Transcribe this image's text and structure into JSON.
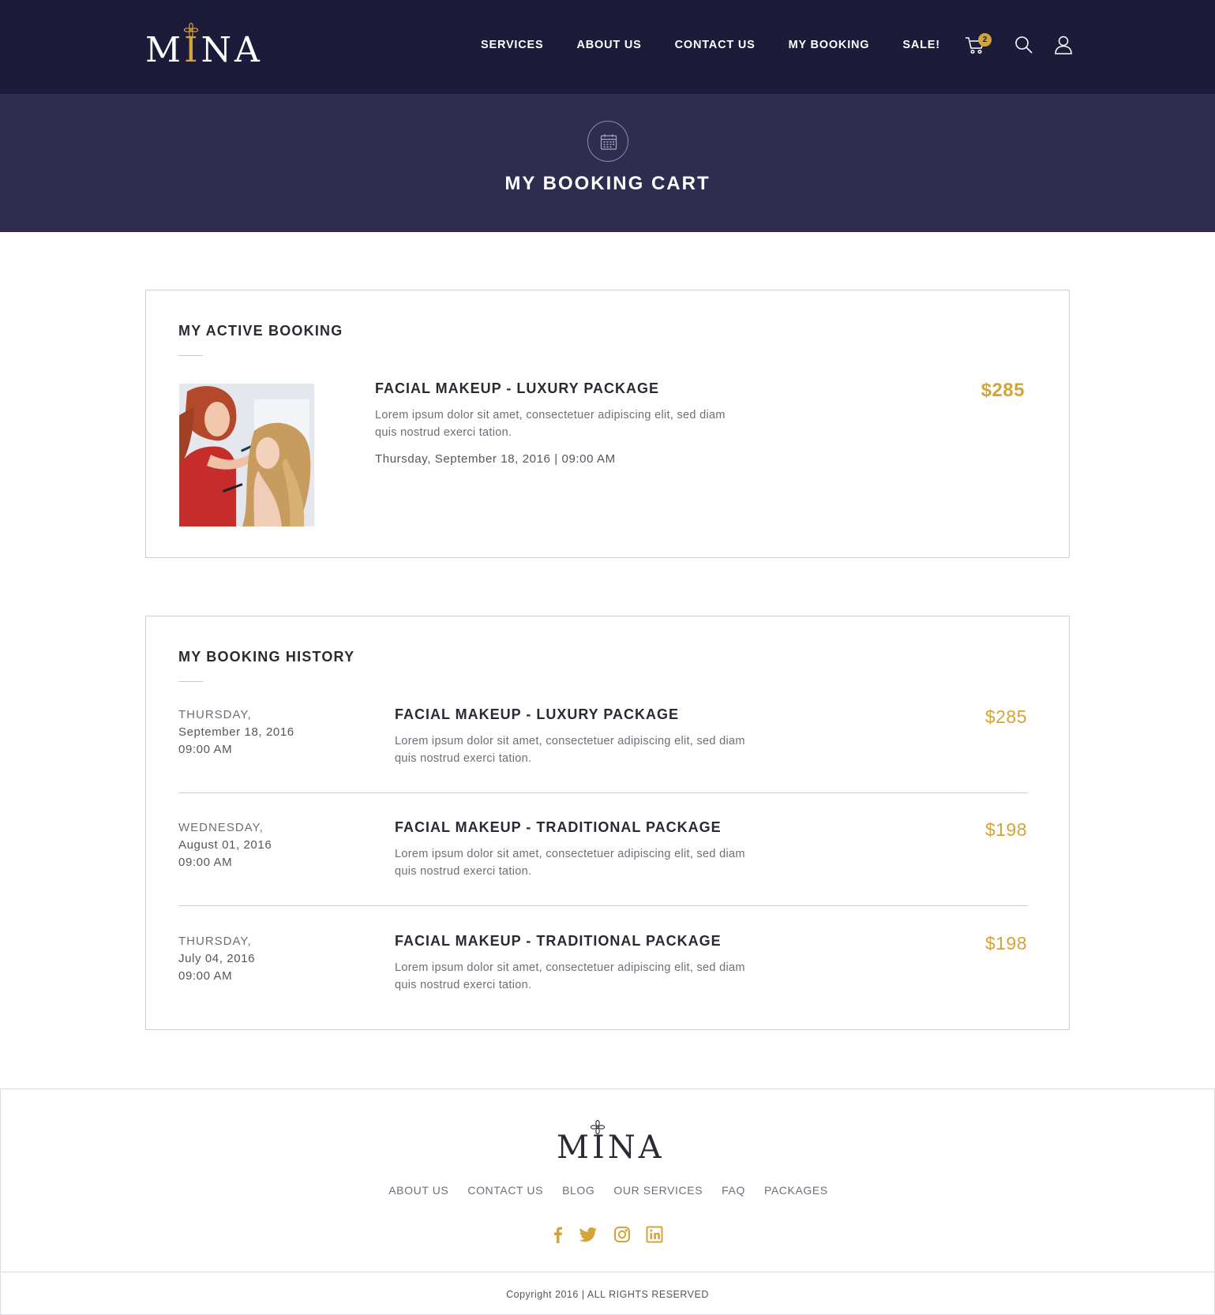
{
  "brand": {
    "name_prefix": "M",
    "name_accent": "I",
    "name_suffix": "NA",
    "accent_color": "#d4a437",
    "header_bg": "#1c1c3a",
    "hero_bg": "#2e2d4f"
  },
  "nav": {
    "items": [
      {
        "label": "SERVICES"
      },
      {
        "label": "ABOUT US"
      },
      {
        "label": "CONTACT US"
      },
      {
        "label": "MY BOOKING"
      },
      {
        "label": "SALE!"
      }
    ],
    "cart_count": "2",
    "icons": [
      "cart-icon",
      "search-icon",
      "user-icon"
    ]
  },
  "hero": {
    "icon": "calendar-icon",
    "title": "MY BOOKING CART"
  },
  "active_booking": {
    "heading": "MY ACTIVE BOOKING",
    "title": "FACIAL MAKEUP - LUXURY PACKAGE",
    "description": "Lorem ipsum dolor sit amet, consectetuer adipiscing elit, sed diam quis nostrud exerci tation.",
    "datetime": "Thursday, September 18, 2016 | 09:00 AM",
    "price": "$285"
  },
  "history": {
    "heading": "MY BOOKING HISTORY",
    "rows": [
      {
        "day": "THURSDAY,",
        "date": "September 18, 2016",
        "time": "09:00 AM",
        "title": "FACIAL MAKEUP - LUXURY PACKAGE",
        "description": "Lorem ipsum dolor sit amet, consectetuer adipiscing elit, sed diam quis nostrud exerci tation.",
        "price": "$285"
      },
      {
        "day": "WEDNESDAY,",
        "date": "August 01, 2016",
        "time": "09:00 AM",
        "title": "FACIAL MAKEUP - TRADITIONAL PACKAGE",
        "description": "Lorem ipsum dolor sit amet, consectetuer adipiscing elit, sed diam quis nostrud exerci tation.",
        "price": "$198"
      },
      {
        "day": "THURSDAY,",
        "date": "July 04, 2016",
        "time": "09:00 AM",
        "title": "FACIAL MAKEUP - TRADITIONAL PACKAGE",
        "description": "Lorem ipsum dolor sit amet, consectetuer adipiscing elit, sed diam quis nostrud exerci tation.",
        "price": "$198"
      }
    ]
  },
  "footer": {
    "links": [
      {
        "label": "ABOUT US"
      },
      {
        "label": "CONTACT US"
      },
      {
        "label": "BLOG"
      },
      {
        "label": "OUR SERVICES"
      },
      {
        "label": "FAQ"
      },
      {
        "label": "PACKAGES"
      }
    ],
    "social": [
      "facebook-icon",
      "twitter-icon",
      "instagram-icon",
      "linkedin-icon"
    ],
    "copyright": "Copyright 2016 | ALL RIGHTS RESERVED"
  }
}
